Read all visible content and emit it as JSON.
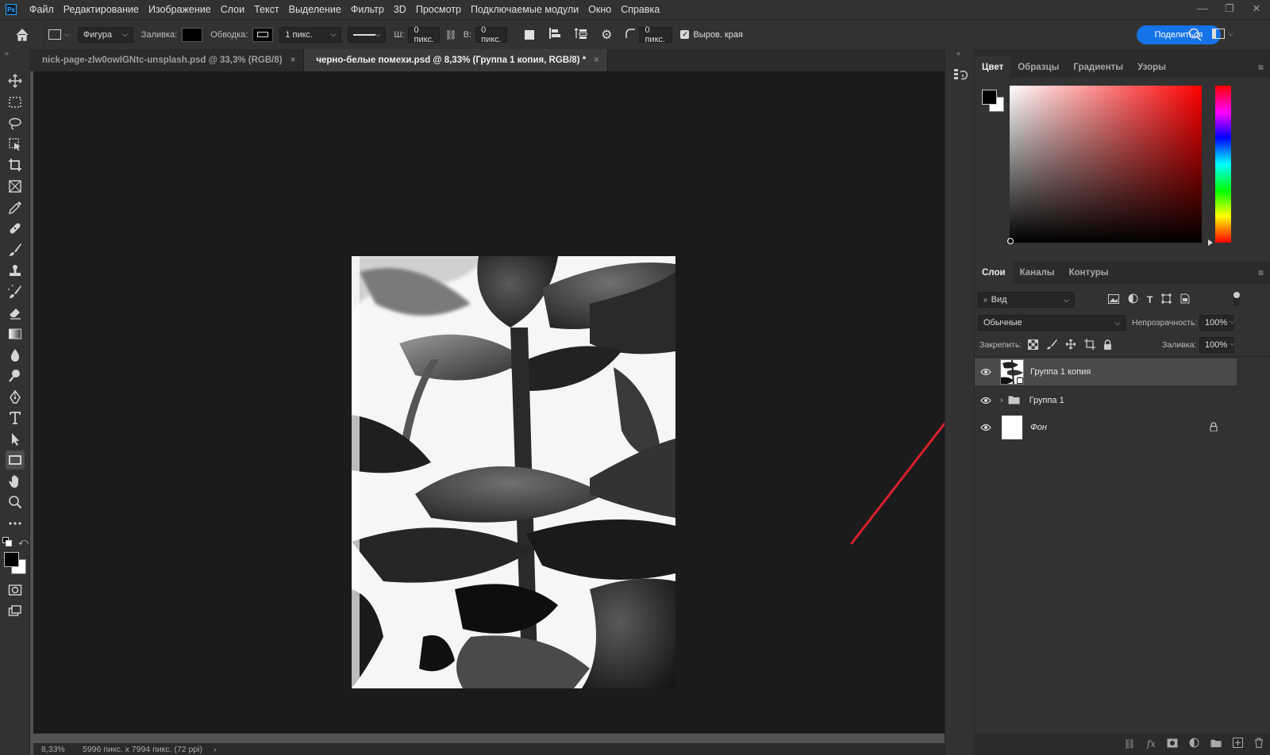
{
  "app": {
    "logo": "Ps",
    "menu": [
      "Файл",
      "Редактирование",
      "Изображение",
      "Слои",
      "Текст",
      "Выделение",
      "Фильтр",
      "3D",
      "Просмотр",
      "Подключаемые модули",
      "Окно",
      "Справка"
    ],
    "window_controls": [
      "—",
      "❐",
      "✕"
    ]
  },
  "options": {
    "shape_mode": "Фигура",
    "fill_label": "Заливка:",
    "stroke_label": "Обводка:",
    "stroke_width": "1 пикс.",
    "w_label": "Ш:",
    "w_value": "0 пикс.",
    "h_label": "В:",
    "h_value": "0 пикс.",
    "radius_value": "0 пикс.",
    "align_edges_label": "Выров. края",
    "align_edges_checked": true,
    "share_label": "Поделиться"
  },
  "documents": {
    "tabs": [
      {
        "title": "nick-page-zlw0owIGNtc-unsplash.psd @ 33,3% (RGB/8)",
        "active": false
      },
      {
        "title": "черно-белые помехи.psd @ 8,33% (Группа 1 копия, RGB/8) *",
        "active": true
      }
    ]
  },
  "status": {
    "zoom": "8,33%",
    "doc_info": "5996 пикс. x 7994 пикс. (72 ppi)"
  },
  "color_panel": {
    "tabs": [
      "Цвет",
      "Образцы",
      "Градиенты",
      "Узоры"
    ],
    "active_tab": "Цвет",
    "foreground": "#000000",
    "background": "#ffffff",
    "hue_color": "#ff0000"
  },
  "layers_panel": {
    "tabs": [
      "Слои",
      "Каналы",
      "Контуры"
    ],
    "active_tab": "Слои",
    "filter_kind": "Вид",
    "blend_mode": "Обычные",
    "opacity_label": "Непрозрачность:",
    "opacity_value": "100%",
    "lock_label": "Закрепить:",
    "fill_label": "Заливка:",
    "fill_value": "100%",
    "layers": [
      {
        "name": "Группа 1 копия",
        "visible": true,
        "selected": true,
        "type": "smart"
      },
      {
        "name": "Группа 1",
        "visible": true,
        "selected": false,
        "type": "group"
      },
      {
        "name": "Фон",
        "visible": true,
        "selected": false,
        "type": "background",
        "locked": true
      }
    ]
  },
  "annotation": {
    "arrow_color": "#d91f2e"
  }
}
